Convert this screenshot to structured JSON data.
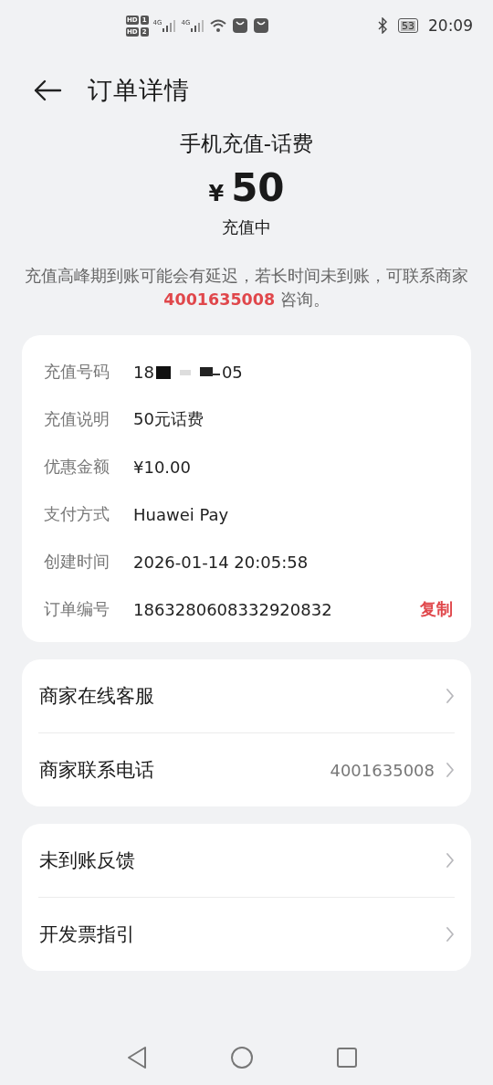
{
  "status_bar": {
    "sims": [
      {
        "hd": "HD",
        "slot": "1",
        "network": "4G"
      },
      {
        "hd": "HD",
        "slot": "2",
        "network": "4G"
      }
    ],
    "battery": "53",
    "time": "20:09"
  },
  "header": {
    "title": "订单详情"
  },
  "summary": {
    "product": "手机充值-话费",
    "currency": "¥",
    "amount": "50",
    "status": "充值中"
  },
  "notice": {
    "text": "充值高峰期到账可能会有延迟，若长时间未到账，可联系商家",
    "phone": "4001635008",
    "suffix": "咨询。"
  },
  "details": [
    {
      "kind": "redacted",
      "label": "充值号码",
      "value": "18",
      "value_end": "05"
    },
    {
      "kind": "plain",
      "label": "充值说明",
      "value": "50元话费"
    },
    {
      "kind": "plain",
      "label": "优惠金额",
      "value": "¥10.00"
    },
    {
      "kind": "plain",
      "label": "支付方式",
      "value": "Huawei Pay"
    },
    {
      "kind": "plain",
      "label": "创建时间",
      "value": "2026-01-14 20:05:58"
    },
    {
      "kind": "copy",
      "label": "订单编号",
      "value": "1863280608332920832",
      "action": "复制"
    }
  ],
  "contact_menu": [
    {
      "label": "商家在线客服"
    },
    {
      "label": "商家联系电话",
      "value": "4001635008"
    }
  ],
  "help_menu": [
    {
      "label": "未到账反馈"
    },
    {
      "label": "开发票指引"
    }
  ]
}
